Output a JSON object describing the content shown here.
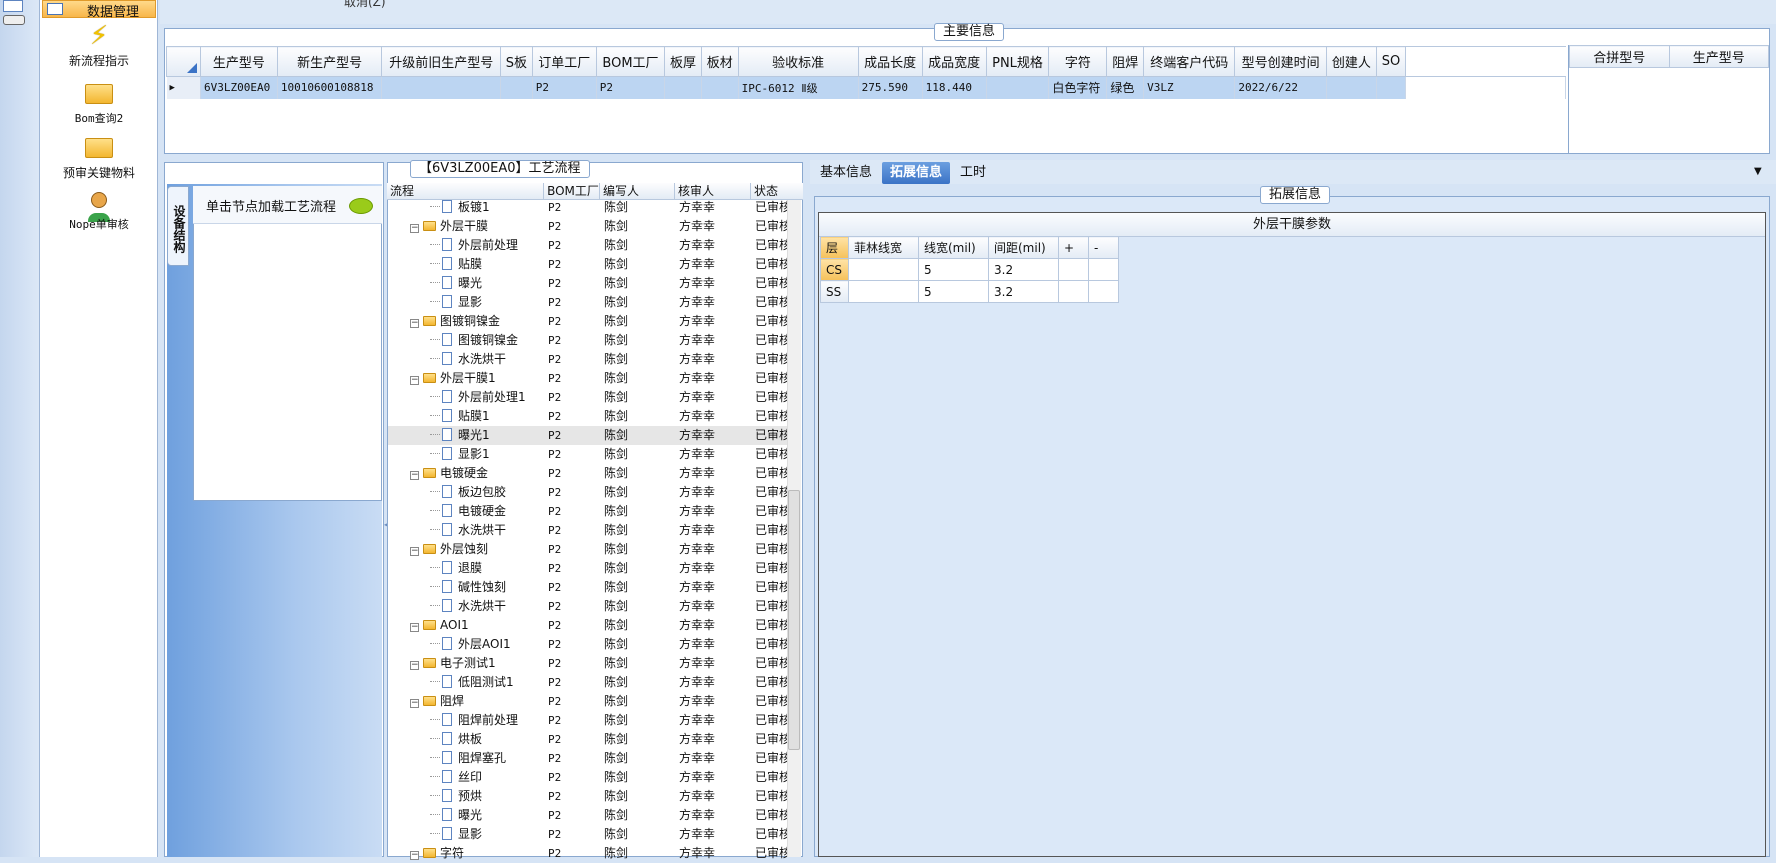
{
  "nav": {
    "selected": "数据管理",
    "items": [
      {
        "label": "新流程指示",
        "icon": "lightning-icon"
      },
      {
        "label": "Bom查询2",
        "icon": "folder-open-icon"
      },
      {
        "label": "预审关键物料",
        "icon": "folder-open-icon"
      },
      {
        "label": "Nope单审核",
        "icon": "user-icon"
      }
    ]
  },
  "top": {
    "partial_text": "取消(Z)"
  },
  "main_info": {
    "title": "主要信息",
    "columns": [
      "生产型号",
      "新生产型号",
      "升级前旧生产型号",
      "S板",
      "订单工厂",
      "BOM工厂",
      "板厚",
      "板材",
      "验收标准",
      "成品长度",
      "成品宽度",
      "PNL规格",
      "字符",
      "阻焊",
      "终端客户代码",
      "型号创建时间",
      "创建人",
      "SO"
    ],
    "row": [
      "6V3LZ00EA0",
      "10010600108818",
      "",
      "",
      "P2",
      "P2",
      "",
      "",
      "IPC-6012 Ⅱ级",
      "275.590",
      "118.440",
      "",
      "白色字符",
      "绿色",
      "V3LZ",
      "2022/6/22",
      "",
      ""
    ],
    "merge_columns": [
      "合拼型号",
      "生产型号"
    ]
  },
  "left_panel": {
    "vertical_tab": "设备结构",
    "load_hint": "单击节点加载工艺流程"
  },
  "process": {
    "title": "【6V3LZ00EA0】工艺流程",
    "columns": [
      "流程",
      "BOM工厂",
      "编写人",
      "核审人",
      "状态"
    ],
    "rows": [
      {
        "level": 2,
        "type": "doc",
        "name": "板镀1",
        "bom": "P2",
        "writer": "陈剑",
        "reviewer": "方幸幸",
        "status": "已审核"
      },
      {
        "level": 1,
        "type": "folder",
        "name": "外层干膜",
        "bom": "P2",
        "writer": "陈剑",
        "reviewer": "方幸幸",
        "status": "已审核"
      },
      {
        "level": 2,
        "type": "doc",
        "name": "外层前处理",
        "bom": "P2",
        "writer": "陈剑",
        "reviewer": "方幸幸",
        "status": "已审核"
      },
      {
        "level": 2,
        "type": "doc",
        "name": "贴膜",
        "bom": "P2",
        "writer": "陈剑",
        "reviewer": "方幸幸",
        "status": "已审核"
      },
      {
        "level": 2,
        "type": "doc",
        "name": "曝光",
        "bom": "P2",
        "writer": "陈剑",
        "reviewer": "方幸幸",
        "status": "已审核"
      },
      {
        "level": 2,
        "type": "doc",
        "name": "显影",
        "bom": "P2",
        "writer": "陈剑",
        "reviewer": "方幸幸",
        "status": "已审核"
      },
      {
        "level": 1,
        "type": "folder",
        "name": "图镀铜镍金",
        "bom": "P2",
        "writer": "陈剑",
        "reviewer": "方幸幸",
        "status": "已审核"
      },
      {
        "level": 2,
        "type": "doc",
        "name": "图镀铜镍金",
        "bom": "P2",
        "writer": "陈剑",
        "reviewer": "方幸幸",
        "status": "已审核"
      },
      {
        "level": 2,
        "type": "doc",
        "name": "水洗烘干",
        "bom": "P2",
        "writer": "陈剑",
        "reviewer": "方幸幸",
        "status": "已审核"
      },
      {
        "level": 1,
        "type": "folder",
        "name": "外层干膜1",
        "bom": "P2",
        "writer": "陈剑",
        "reviewer": "方幸幸",
        "status": "已审核"
      },
      {
        "level": 2,
        "type": "doc",
        "name": "外层前处理1",
        "bom": "P2",
        "writer": "陈剑",
        "reviewer": "方幸幸",
        "status": "已审核"
      },
      {
        "level": 2,
        "type": "doc",
        "name": "贴膜1",
        "bom": "P2",
        "writer": "陈剑",
        "reviewer": "方幸幸",
        "status": "已审核"
      },
      {
        "level": 2,
        "type": "doc",
        "name": "曝光1",
        "bom": "P2",
        "writer": "陈剑",
        "reviewer": "方幸幸",
        "status": "已审核",
        "highlight": true
      },
      {
        "level": 2,
        "type": "doc",
        "name": "显影1",
        "bom": "P2",
        "writer": "陈剑",
        "reviewer": "方幸幸",
        "status": "已审核"
      },
      {
        "level": 1,
        "type": "folder",
        "name": "电镀硬金",
        "bom": "P2",
        "writer": "陈剑",
        "reviewer": "方幸幸",
        "status": "已审核"
      },
      {
        "level": 2,
        "type": "doc",
        "name": "板边包胶",
        "bom": "P2",
        "writer": "陈剑",
        "reviewer": "方幸幸",
        "status": "已审核"
      },
      {
        "level": 2,
        "type": "doc",
        "name": "电镀硬金",
        "bom": "P2",
        "writer": "陈剑",
        "reviewer": "方幸幸",
        "status": "已审核"
      },
      {
        "level": 2,
        "type": "doc",
        "name": "水洗烘干",
        "bom": "P2",
        "writer": "陈剑",
        "reviewer": "方幸幸",
        "status": "已审核"
      },
      {
        "level": 1,
        "type": "folder",
        "name": "外层蚀刻",
        "bom": "P2",
        "writer": "陈剑",
        "reviewer": "方幸幸",
        "status": "已审核"
      },
      {
        "level": 2,
        "type": "doc",
        "name": "退膜",
        "bom": "P2",
        "writer": "陈剑",
        "reviewer": "方幸幸",
        "status": "已审核"
      },
      {
        "level": 2,
        "type": "doc",
        "name": "碱性蚀刻",
        "bom": "P2",
        "writer": "陈剑",
        "reviewer": "方幸幸",
        "status": "已审核"
      },
      {
        "level": 2,
        "type": "doc",
        "name": "水洗烘干",
        "bom": "P2",
        "writer": "陈剑",
        "reviewer": "方幸幸",
        "status": "已审核"
      },
      {
        "level": 1,
        "type": "folder",
        "name": "AOI1",
        "bom": "P2",
        "writer": "陈剑",
        "reviewer": "方幸幸",
        "status": "已审核"
      },
      {
        "level": 2,
        "type": "doc",
        "name": "外层AOI1",
        "bom": "P2",
        "writer": "陈剑",
        "reviewer": "方幸幸",
        "status": "已审核"
      },
      {
        "level": 1,
        "type": "folder",
        "name": "电子测试1",
        "bom": "P2",
        "writer": "陈剑",
        "reviewer": "方幸幸",
        "status": "已审核"
      },
      {
        "level": 2,
        "type": "doc",
        "name": "低阻测试1",
        "bom": "P2",
        "writer": "陈剑",
        "reviewer": "方幸幸",
        "status": "已审核"
      },
      {
        "level": 1,
        "type": "folder",
        "name": "阻焊",
        "bom": "P2",
        "writer": "陈剑",
        "reviewer": "方幸幸",
        "status": "已审核"
      },
      {
        "level": 2,
        "type": "doc",
        "name": "阻焊前处理",
        "bom": "P2",
        "writer": "陈剑",
        "reviewer": "方幸幸",
        "status": "已审核"
      },
      {
        "level": 2,
        "type": "doc",
        "name": "烘板",
        "bom": "P2",
        "writer": "陈剑",
        "reviewer": "方幸幸",
        "status": "已审核"
      },
      {
        "level": 2,
        "type": "doc",
        "name": "阻焊塞孔",
        "bom": "P2",
        "writer": "陈剑",
        "reviewer": "方幸幸",
        "status": "已审核"
      },
      {
        "level": 2,
        "type": "doc",
        "name": "丝印",
        "bom": "P2",
        "writer": "陈剑",
        "reviewer": "方幸幸",
        "status": "已审核"
      },
      {
        "level": 2,
        "type": "doc",
        "name": "预烘",
        "bom": "P2",
        "writer": "陈剑",
        "reviewer": "方幸幸",
        "status": "已审核"
      },
      {
        "level": 2,
        "type": "doc",
        "name": "曝光",
        "bom": "P2",
        "writer": "陈剑",
        "reviewer": "方幸幸",
        "status": "已审核"
      },
      {
        "level": 2,
        "type": "doc",
        "name": "显影",
        "bom": "P2",
        "writer": "陈剑",
        "reviewer": "方幸幸",
        "status": "已审核"
      },
      {
        "level": 1,
        "type": "folder",
        "name": "字符",
        "bom": "P2",
        "writer": "陈剑",
        "reviewer": "方幸幸",
        "status": "已审核"
      }
    ]
  },
  "right": {
    "tabs": [
      {
        "label": "基本信息",
        "active": false
      },
      {
        "label": "拓展信息",
        "active": true
      },
      {
        "label": "工时",
        "active": false
      }
    ],
    "group_title": "拓展信息",
    "section_title": "外层干膜参数",
    "param_columns": [
      "层",
      "菲林线宽",
      "线宽(mil)",
      "间距(mil)",
      "+",
      "-"
    ],
    "param_rows": [
      {
        "layer": "CS",
        "film": "",
        "width": "5",
        "spacing": "3.2"
      },
      {
        "layer": "SS",
        "film": "",
        "width": "5",
        "spacing": "3.2"
      }
    ]
  },
  "colors": {
    "selected_row": "#bcd5f2",
    "active_tab": "#3b73c6",
    "nav_selected": "#f8b64a"
  }
}
